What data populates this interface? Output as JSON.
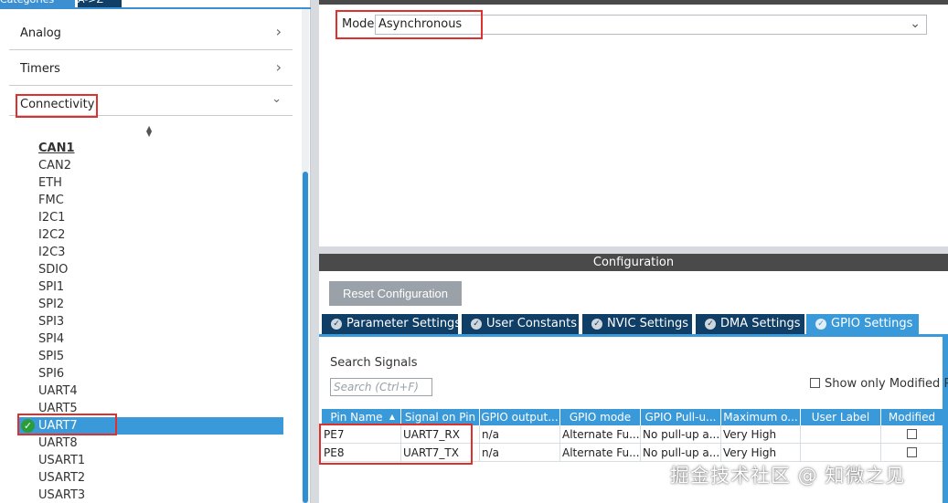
{
  "left": {
    "top_tabs": [
      "Categories",
      "A->Z"
    ],
    "categories": [
      {
        "label": "Analog",
        "chevron": "right"
      },
      {
        "label": "Timers",
        "chevron": "right"
      },
      {
        "label": "Connectivity",
        "chevron": "down"
      }
    ],
    "items": [
      {
        "label": "CAN1",
        "style": "bold"
      },
      {
        "label": "CAN2"
      },
      {
        "label": "ETH"
      },
      {
        "label": "FMC"
      },
      {
        "label": "I2C1"
      },
      {
        "label": "I2C2"
      },
      {
        "label": "I2C3"
      },
      {
        "label": "SDIO"
      },
      {
        "label": "SPI1"
      },
      {
        "label": "SPI2"
      },
      {
        "label": "SPI3"
      },
      {
        "label": "SPI4"
      },
      {
        "label": "SPI5"
      },
      {
        "label": "SPI6"
      },
      {
        "label": "UART4"
      },
      {
        "label": "UART5"
      },
      {
        "label": "UART7",
        "selected": true,
        "icon": "check-circle-icon"
      },
      {
        "label": "UART8"
      },
      {
        "label": "USART1"
      },
      {
        "label": "USART2"
      },
      {
        "label": "USART3"
      }
    ]
  },
  "mode": {
    "label": "Mode",
    "value": "Asynchronous"
  },
  "config": {
    "title": "Configuration",
    "reset_button": "Reset Configuration",
    "tabs": [
      {
        "label": "Parameter Settings"
      },
      {
        "label": "User Constants"
      },
      {
        "label": "NVIC Settings"
      },
      {
        "label": "DMA Settings"
      },
      {
        "label": "GPIO Settings",
        "active": true
      }
    ],
    "search": {
      "label": "Search Signals",
      "placeholder": "Search (Ctrl+F)"
    },
    "show_modified_label": "Show only Modified Pi",
    "table": {
      "headers": [
        "Pin Name",
        "Signal on Pin",
        "GPIO output...",
        "GPIO mode",
        "GPIO Pull-u...",
        "Maximum o...",
        "User Label",
        "Modified"
      ],
      "rows": [
        [
          "PE7",
          "UART7_RX",
          "n/a",
          "Alternate Fu...",
          "No pull-up a...",
          "Very High",
          "",
          ""
        ],
        [
          "PE8",
          "UART7_TX",
          "n/a",
          "Alternate Fu...",
          "No pull-up a...",
          "Very High",
          "",
          ""
        ]
      ]
    }
  },
  "watermark": "掘金技术社区 @ 知微之见",
  "colors": {
    "accent": "#3a9ad9",
    "tab_dark": "#0f3e66",
    "highlight": "#e0302d",
    "header_bar": "#4a4a4a"
  }
}
